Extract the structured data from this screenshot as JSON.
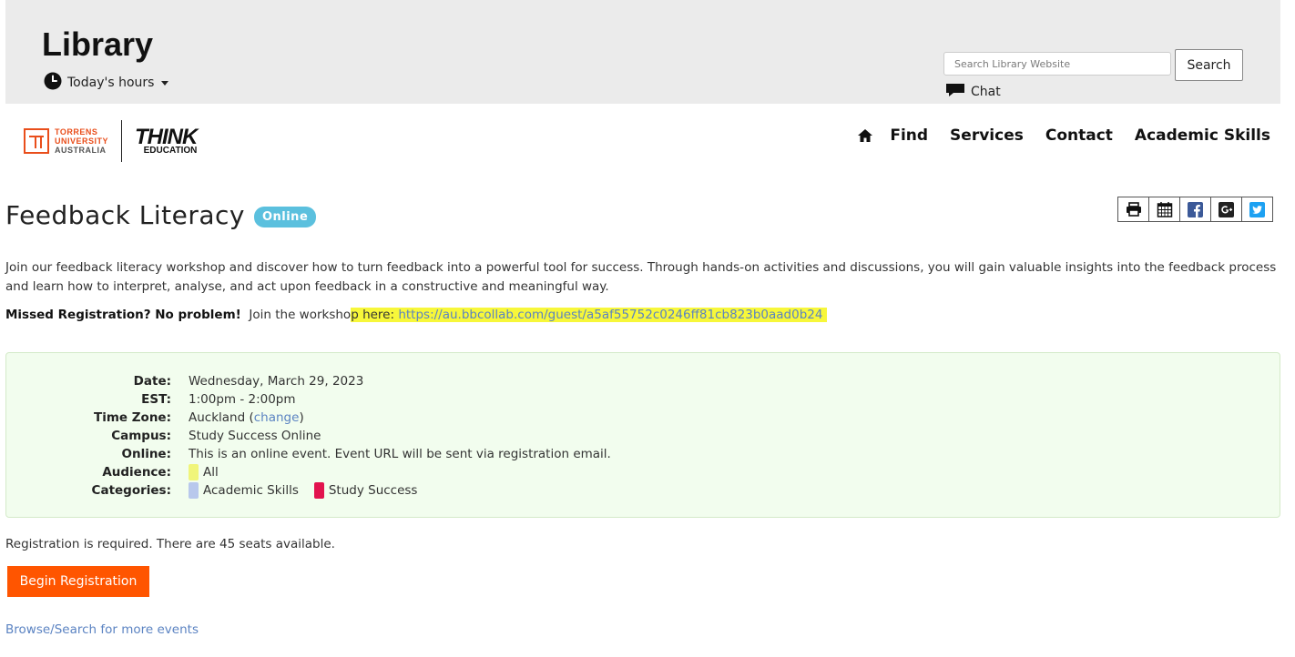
{
  "header": {
    "site_title": "Library",
    "hours_label": "Today's hours",
    "search_placeholder": "Search Library Website",
    "search_button": "Search",
    "chat_label": "Chat"
  },
  "logos": {
    "torrens_line1": "TORRENS",
    "torrens_line2": "UNIVERSITY",
    "torrens_line3": "AUSTRALIA",
    "think_word": "THINK",
    "think_sub": "EDUCATION"
  },
  "nav": {
    "home_icon": "home-icon",
    "items": [
      "Find",
      "Services",
      "Contact",
      "Academic Skills"
    ]
  },
  "event": {
    "title": "Feedback Literacy",
    "badge": "Online",
    "share_icons": [
      "print-icon",
      "calendar-icon",
      "facebook-icon",
      "google-plus-icon",
      "twitter-icon"
    ],
    "description": "Join our feedback literacy workshop and discover how to turn feedback into a powerful tool for success. Through hands-on activities and discussions, you will gain valuable insights into the feedback process and learn how to interpret, analyse, and act upon feedback in a constructive and meaningful way.",
    "missed_bold": "Missed Registration? No problem!",
    "missed_text_a": "Join the worksho",
    "missed_text_b": "p here: ",
    "missed_url": "https://au.bbcollab.com/guest/a5af55752c0246ff81cb823b0aad0b24"
  },
  "details": {
    "date_label": "Date:",
    "date_value": "Wednesday, March 29, 2023",
    "est_label": "EST:",
    "est_value": "1:00pm - 2:00pm",
    "tz_label": "Time Zone:",
    "tz_value": "Auckland (",
    "tz_change": "change",
    "tz_close": ")",
    "campus_label": "Campus:",
    "campus_value": "Study Success Online",
    "online_label": "Online:",
    "online_value": "This is an online event. Event URL will be sent via registration email.",
    "audience_label": "Audience:",
    "audience_value": "All",
    "categories_label": "Categories:",
    "category_1": "Academic Skills",
    "category_2": "Study Success",
    "colors": {
      "audience_all": "#f0f57a",
      "academic_skills": "#b8c8ec",
      "study_success": "#e2134e"
    }
  },
  "registration": {
    "note": "Registration is required. There are 45 seats available.",
    "button": "Begin Registration",
    "browse_link": "Browse/Search for more events"
  },
  "colors": {
    "accent_orange": "#ff5500",
    "badge_blue": "#5bc0de",
    "link_blue": "#5b83c2"
  }
}
